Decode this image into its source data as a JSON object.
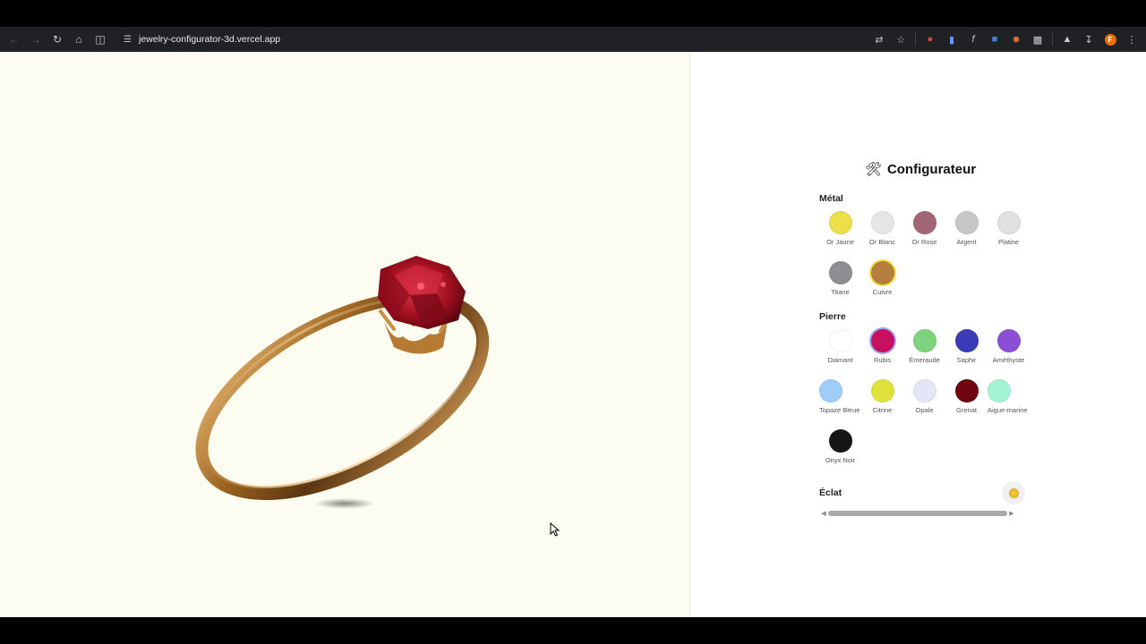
{
  "browser": {
    "url": "jewelry-configurator-3d.vercel.app"
  },
  "configurator": {
    "title": "Configurateur",
    "title_icon": "hammer-wrench-icon",
    "metal": {
      "label": "Métal",
      "options": [
        {
          "name": "Or Jaune",
          "color": "#ecdf4a"
        },
        {
          "name": "Or Blanc",
          "color": "#e6e6e4"
        },
        {
          "name": "Or Rose",
          "color": "#a36677"
        },
        {
          "name": "Argent",
          "color": "#c7c7c7"
        },
        {
          "name": "Platine",
          "color": "#e0e0e0"
        },
        {
          "name": "Titane",
          "color": "#8d8f92"
        },
        {
          "name": "Cuivre",
          "color": "#b57e3f"
        }
      ],
      "selected": "Cuivre"
    },
    "stone": {
      "label": "Pierre",
      "options": [
        {
          "name": "Diamant",
          "color": "#ffffff"
        },
        {
          "name": "Rubis",
          "color": "#c81060"
        },
        {
          "name": "Émeraude",
          "color": "#7ed37c"
        },
        {
          "name": "Saphir",
          "color": "#3b3bb5"
        },
        {
          "name": "Améthyste",
          "color": "#8a4fd2"
        },
        {
          "name": "Topaze Bleue",
          "color": "#9fcdf7"
        },
        {
          "name": "Citrine",
          "color": "#dfe23a"
        },
        {
          "name": "Opale",
          "color": "#e4e6f6"
        },
        {
          "name": "Grenat",
          "color": "#6e0510"
        },
        {
          "name": "Aigue-marine",
          "color": "#a4f3d3"
        },
        {
          "name": "Onyx Noir",
          "color": "#161616"
        }
      ],
      "selected": "Rubis"
    },
    "brightness": {
      "label": "Éclat"
    }
  }
}
